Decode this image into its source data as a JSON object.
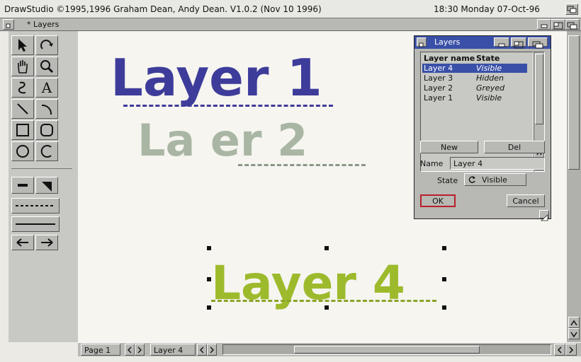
{
  "screen": {
    "title": "DrawStudio ©1995,1996 Graham Dean, Andy Dean. V1.0.2 (Nov 10 1996)",
    "clock": "18:30 Monday 07-Oct-96"
  },
  "window": {
    "title": "* Layers"
  },
  "canvas": {
    "layer1_text": "Layer 1",
    "layer2_text": "La er 2",
    "layer4_text": "Layer 4",
    "colors": {
      "layer1": "#3e3c9a",
      "layer2": "#a9b6a4",
      "layer4": "#9dba2c"
    }
  },
  "toolbox": {
    "text_tool_label": "A"
  },
  "bottom": {
    "page_label": "Page 1",
    "layer_label": "Layer 4"
  },
  "layers_dialog": {
    "title": "Layers",
    "header_name": "Layer name",
    "header_state": "State",
    "rows": [
      {
        "name": "Layer 4",
        "state": "Visible"
      },
      {
        "name": "Layer 3",
        "state": "Hidden"
      },
      {
        "name": "Layer 2",
        "state": "Greyed"
      },
      {
        "name": "Layer 1",
        "state": "Visible"
      }
    ],
    "new_label": "New",
    "del_label": "Del",
    "name_label": "Name",
    "name_value": "Layer 4",
    "state_label": "State",
    "state_value": "Visible",
    "ok_label": "OK",
    "cancel_label": "Cancel"
  }
}
